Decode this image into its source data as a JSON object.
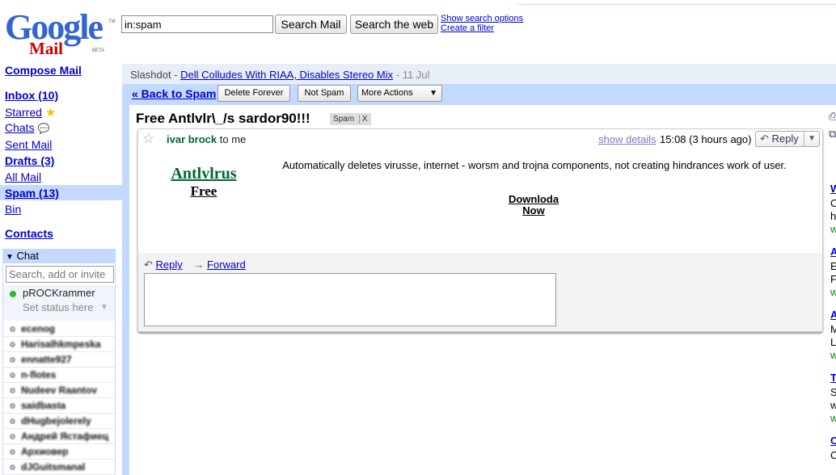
{
  "header": {
    "logo_google": "Google",
    "logo_mail": "Mail",
    "logo_beta": "BETA",
    "logo_tm": "TM",
    "search_value": "in:spam",
    "search_mail_label": "Search Mail",
    "search_web_label": "Search the web",
    "show_options_label": "Show search options",
    "create_filter_label": "Create a filter"
  },
  "nav": {
    "compose": "Compose Mail",
    "inbox": "Inbox (10)",
    "starred": "Starred",
    "chats": "Chats",
    "sent": "Sent Mail",
    "drafts": "Drafts (3)",
    "all": "All Mail",
    "spam": "Spam (13)",
    "bin": "Bin",
    "contacts": "Contacts"
  },
  "chat": {
    "header": "Chat",
    "search_placeholder": "Search, add or invite",
    "me_name": "pROCKrammer",
    "me_status": "Set status here",
    "contacts": [
      "ecenog",
      "Harisalhkmpeska",
      "ennatte927",
      "n-flotes",
      "Nudeev Raantov",
      "saidbasta",
      "dHugbejoIerely",
      "Андрей Ястафиец",
      "Архиовер",
      "dJGuitsmanal"
    ]
  },
  "webclip": {
    "source": "Slashdot",
    "separator": " - ",
    "headline": "Dell Colludes With RIAA, Disables Stereo Mix",
    "date": " - 11 Jul"
  },
  "actions": {
    "back": "« Back to Spam",
    "delete_forever": "Delete Forever",
    "not_spam": "Not Spam",
    "more_actions": "More Actions",
    "more_arrow": "▼"
  },
  "message": {
    "subject": "Free Antlvlr\\_/s sardor90!!!",
    "spam_label": "Spam",
    "spam_label_x": "X",
    "sender": "ivar brock",
    "to": "to me",
    "show_details": "show details",
    "time": "15:08 (3 hours ago)",
    "reply_btn": "Reply",
    "reply_arrow": "▼",
    "body_title": "Antlvlrus",
    "body_subtitle": "Free",
    "body_text": "Automatically deletes virusse, internet - worsm and trojna components, not creating hindrances work of user.",
    "download_1": "Downloda",
    "download_2": "Now",
    "reply_link": "Reply",
    "forward_link": "Forward"
  },
  "right": {
    "letters": [
      "W",
      "C",
      "h",
      "w",
      "A",
      "E",
      "F",
      "w",
      "A",
      "M",
      "L",
      "w",
      "T",
      "S",
      "w",
      "w",
      "C",
      "C"
    ]
  },
  "colors": {
    "nav_bg": "#c3d9ff",
    "link": "#0000cc",
    "sender_green": "#006633",
    "body_title_green": "#006633"
  }
}
